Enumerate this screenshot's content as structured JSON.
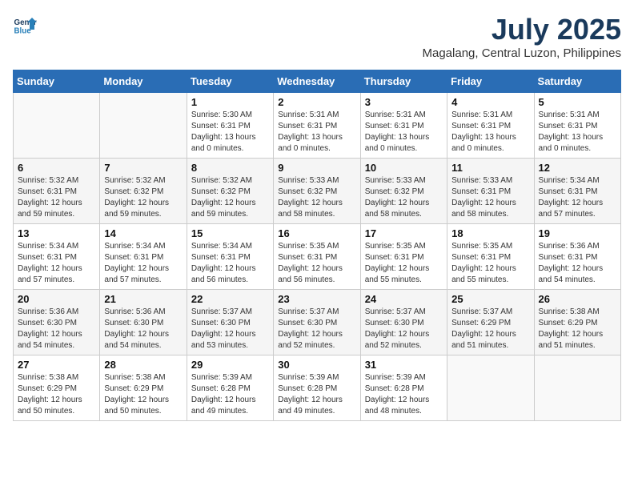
{
  "header": {
    "logo_line1": "General",
    "logo_line2": "Blue",
    "month": "July 2025",
    "location": "Magalang, Central Luzon, Philippines"
  },
  "days_of_week": [
    "Sunday",
    "Monday",
    "Tuesday",
    "Wednesday",
    "Thursday",
    "Friday",
    "Saturday"
  ],
  "weeks": [
    [
      {
        "day": "",
        "info": ""
      },
      {
        "day": "",
        "info": ""
      },
      {
        "day": "1",
        "info": "Sunrise: 5:30 AM\nSunset: 6:31 PM\nDaylight: 13 hours\nand 0 minutes."
      },
      {
        "day": "2",
        "info": "Sunrise: 5:31 AM\nSunset: 6:31 PM\nDaylight: 13 hours\nand 0 minutes."
      },
      {
        "day": "3",
        "info": "Sunrise: 5:31 AM\nSunset: 6:31 PM\nDaylight: 13 hours\nand 0 minutes."
      },
      {
        "day": "4",
        "info": "Sunrise: 5:31 AM\nSunset: 6:31 PM\nDaylight: 13 hours\nand 0 minutes."
      },
      {
        "day": "5",
        "info": "Sunrise: 5:31 AM\nSunset: 6:31 PM\nDaylight: 13 hours\nand 0 minutes."
      }
    ],
    [
      {
        "day": "6",
        "info": "Sunrise: 5:32 AM\nSunset: 6:31 PM\nDaylight: 12 hours\nand 59 minutes."
      },
      {
        "day": "7",
        "info": "Sunrise: 5:32 AM\nSunset: 6:32 PM\nDaylight: 12 hours\nand 59 minutes."
      },
      {
        "day": "8",
        "info": "Sunrise: 5:32 AM\nSunset: 6:32 PM\nDaylight: 12 hours\nand 59 minutes."
      },
      {
        "day": "9",
        "info": "Sunrise: 5:33 AM\nSunset: 6:32 PM\nDaylight: 12 hours\nand 58 minutes."
      },
      {
        "day": "10",
        "info": "Sunrise: 5:33 AM\nSunset: 6:32 PM\nDaylight: 12 hours\nand 58 minutes."
      },
      {
        "day": "11",
        "info": "Sunrise: 5:33 AM\nSunset: 6:31 PM\nDaylight: 12 hours\nand 58 minutes."
      },
      {
        "day": "12",
        "info": "Sunrise: 5:34 AM\nSunset: 6:31 PM\nDaylight: 12 hours\nand 57 minutes."
      }
    ],
    [
      {
        "day": "13",
        "info": "Sunrise: 5:34 AM\nSunset: 6:31 PM\nDaylight: 12 hours\nand 57 minutes."
      },
      {
        "day": "14",
        "info": "Sunrise: 5:34 AM\nSunset: 6:31 PM\nDaylight: 12 hours\nand 57 minutes."
      },
      {
        "day": "15",
        "info": "Sunrise: 5:34 AM\nSunset: 6:31 PM\nDaylight: 12 hours\nand 56 minutes."
      },
      {
        "day": "16",
        "info": "Sunrise: 5:35 AM\nSunset: 6:31 PM\nDaylight: 12 hours\nand 56 minutes."
      },
      {
        "day": "17",
        "info": "Sunrise: 5:35 AM\nSunset: 6:31 PM\nDaylight: 12 hours\nand 55 minutes."
      },
      {
        "day": "18",
        "info": "Sunrise: 5:35 AM\nSunset: 6:31 PM\nDaylight: 12 hours\nand 55 minutes."
      },
      {
        "day": "19",
        "info": "Sunrise: 5:36 AM\nSunset: 6:31 PM\nDaylight: 12 hours\nand 54 minutes."
      }
    ],
    [
      {
        "day": "20",
        "info": "Sunrise: 5:36 AM\nSunset: 6:30 PM\nDaylight: 12 hours\nand 54 minutes."
      },
      {
        "day": "21",
        "info": "Sunrise: 5:36 AM\nSunset: 6:30 PM\nDaylight: 12 hours\nand 54 minutes."
      },
      {
        "day": "22",
        "info": "Sunrise: 5:37 AM\nSunset: 6:30 PM\nDaylight: 12 hours\nand 53 minutes."
      },
      {
        "day": "23",
        "info": "Sunrise: 5:37 AM\nSunset: 6:30 PM\nDaylight: 12 hours\nand 52 minutes."
      },
      {
        "day": "24",
        "info": "Sunrise: 5:37 AM\nSunset: 6:30 PM\nDaylight: 12 hours\nand 52 minutes."
      },
      {
        "day": "25",
        "info": "Sunrise: 5:37 AM\nSunset: 6:29 PM\nDaylight: 12 hours\nand 51 minutes."
      },
      {
        "day": "26",
        "info": "Sunrise: 5:38 AM\nSunset: 6:29 PM\nDaylight: 12 hours\nand 51 minutes."
      }
    ],
    [
      {
        "day": "27",
        "info": "Sunrise: 5:38 AM\nSunset: 6:29 PM\nDaylight: 12 hours\nand 50 minutes."
      },
      {
        "day": "28",
        "info": "Sunrise: 5:38 AM\nSunset: 6:29 PM\nDaylight: 12 hours\nand 50 minutes."
      },
      {
        "day": "29",
        "info": "Sunrise: 5:39 AM\nSunset: 6:28 PM\nDaylight: 12 hours\nand 49 minutes."
      },
      {
        "day": "30",
        "info": "Sunrise: 5:39 AM\nSunset: 6:28 PM\nDaylight: 12 hours\nand 49 minutes."
      },
      {
        "day": "31",
        "info": "Sunrise: 5:39 AM\nSunset: 6:28 PM\nDaylight: 12 hours\nand 48 minutes."
      },
      {
        "day": "",
        "info": ""
      },
      {
        "day": "",
        "info": ""
      }
    ]
  ]
}
